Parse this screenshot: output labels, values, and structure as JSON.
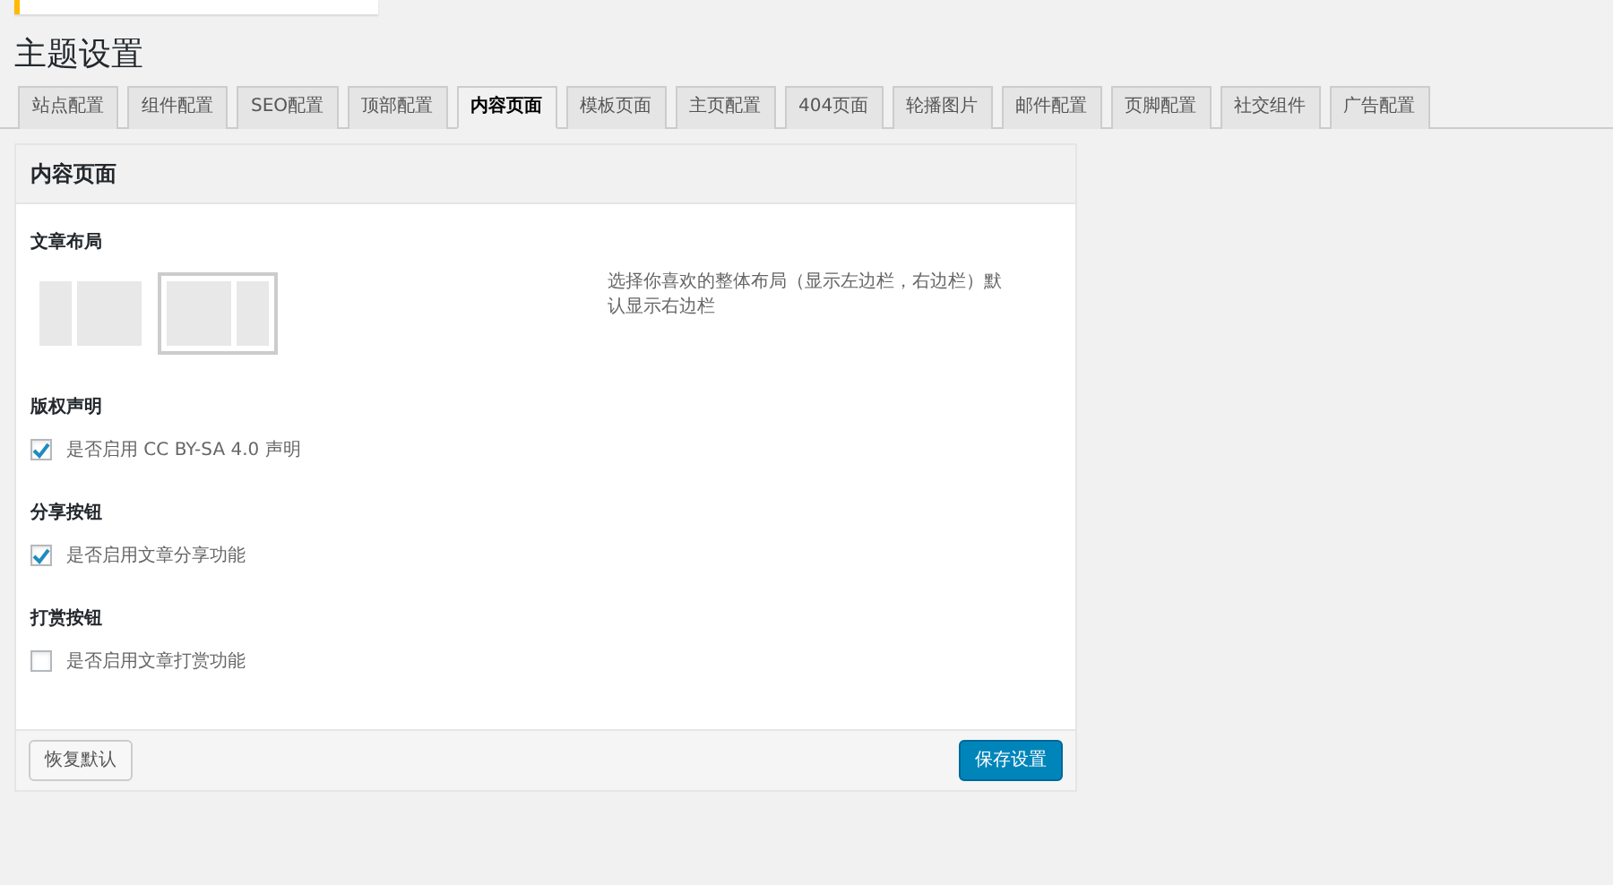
{
  "page_title": "主题设置",
  "tabs": [
    {
      "label": "站点配置",
      "selected": false
    },
    {
      "label": "组件配置",
      "selected": false
    },
    {
      "label": "SEO配置",
      "selected": false
    },
    {
      "label": "顶部配置",
      "selected": false
    },
    {
      "label": "内容页面",
      "selected": true
    },
    {
      "label": "模板页面",
      "selected": false
    },
    {
      "label": "主页配置",
      "selected": false
    },
    {
      "label": "404页面",
      "selected": false
    },
    {
      "label": "轮播图片",
      "selected": false
    },
    {
      "label": "邮件配置",
      "selected": false
    },
    {
      "label": "页脚配置",
      "selected": false
    },
    {
      "label": "社交组件",
      "selected": false
    },
    {
      "label": "广告配置",
      "selected": false
    }
  ],
  "panel": {
    "title": "内容页面",
    "layout": {
      "label": "文章布局",
      "options": [
        {
          "kind": "left-sidebar",
          "selected": false
        },
        {
          "kind": "right-sidebar",
          "selected": true
        }
      ],
      "description": "选择你喜欢的整体布局（显示左边栏，右边栏）默认显示右边栏"
    },
    "settings": [
      {
        "label": "版权声明",
        "checkbox_label": "是否启用 CC BY-SA 4.0 声明",
        "checked": true
      },
      {
        "label": "分享按钮",
        "checkbox_label": "是否启用文章分享功能",
        "checked": true
      },
      {
        "label": "打赏按钮",
        "checkbox_label": "是否启用文章打赏功能",
        "checked": false
      }
    ],
    "reset_button": "恢复默认",
    "save_button": "保存设置"
  }
}
